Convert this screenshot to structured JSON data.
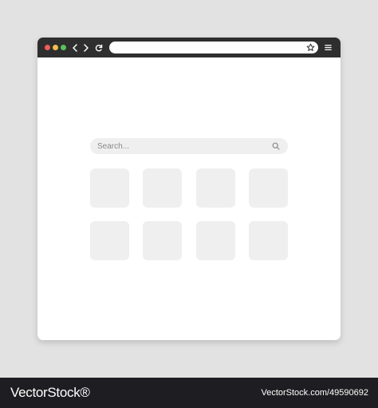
{
  "browser": {
    "address_value": "",
    "traffic_lights": {
      "close_color": "#ef5d59",
      "minimize_color": "#f4bf4f",
      "maximize_color": "#5ac25a"
    },
    "toolbar_color": "#2e2e2e",
    "icons": {
      "back": "chevron-left-icon",
      "forward": "chevron-right-icon",
      "reload": "reload-icon",
      "bookmark": "star-icon",
      "menu": "hamburger-menu-icon"
    }
  },
  "content": {
    "search": {
      "placeholder": "Search...",
      "icon": "search-icon"
    },
    "shortcut_tiles": {
      "rows": 2,
      "columns": 4,
      "count": 8
    }
  },
  "watermark": {
    "brand": "VectorStock®",
    "id_text": "VectorStock.com/49590692"
  }
}
